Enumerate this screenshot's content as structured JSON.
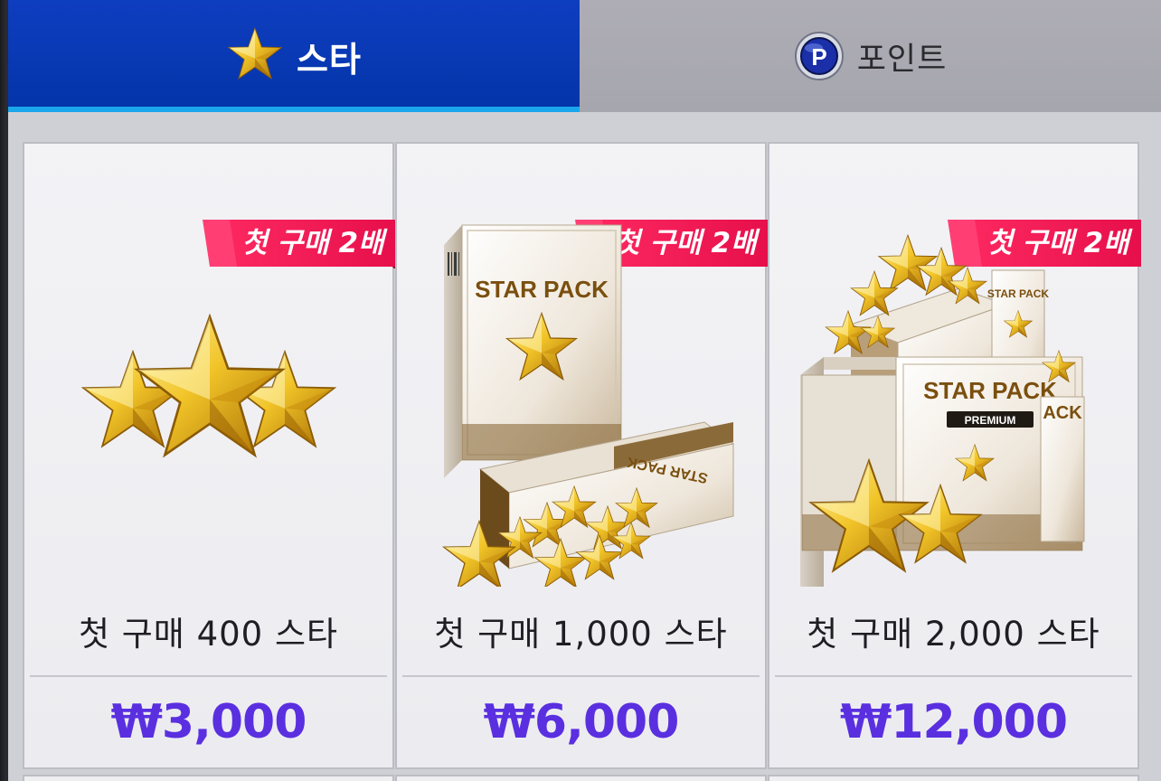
{
  "tabs": [
    {
      "label": "스타",
      "icon": "star-icon",
      "active": true
    },
    {
      "label": "포인트",
      "icon": "point-coin-icon",
      "active": false
    }
  ],
  "products": [
    {
      "badge": "첫 구매 2배",
      "name": "첫 구매 400 스타",
      "price": "₩3,000",
      "image": "three-stars-icon"
    },
    {
      "badge": "첫 구매 2배",
      "name": "첫 구매 1,000 스타",
      "price": "₩6,000",
      "image": "star-pack-box-icon",
      "pack_label": "STAR PACK"
    },
    {
      "badge": "첫 구매 2배",
      "name": "첫 구매 2,000 스타",
      "price": "₩12,000",
      "image": "star-pack-premium-icon",
      "pack_label": "STAR PACK",
      "pack_sublabel": "PREMIUM"
    }
  ],
  "colors": {
    "active_tab": "#0a3ab8",
    "active_tab_underline": "#19a6ea",
    "inactive_tab": "#aaaab2",
    "price": "#5a2fe0",
    "badge": "#ee1550"
  }
}
